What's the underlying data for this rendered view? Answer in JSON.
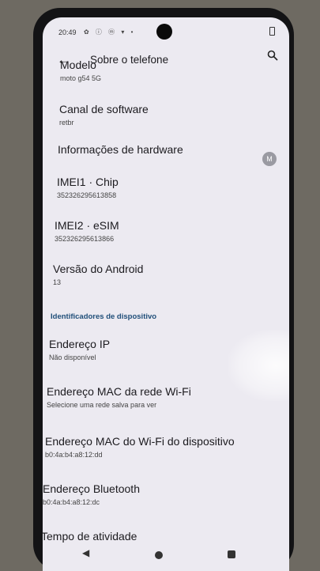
{
  "status_bar": {
    "time": "20:49",
    "icons": "✿ ⓘ ⓜ ▾ •"
  },
  "app_bar": {
    "back_glyph": "←",
    "title": "Sobre o telefone"
  },
  "items": [
    {
      "title": "Modelo",
      "subtitle": "moto g54 5G"
    },
    {
      "title": "Canal de software",
      "subtitle": "retbr"
    },
    {
      "title": "Informações de hardware",
      "subtitle": ""
    },
    {
      "title": "IMEI1 · Chip",
      "subtitle": "352326295613858"
    },
    {
      "title": "IMEI2 · eSIM",
      "subtitle": "352326295613866"
    },
    {
      "title": "Versão do Android",
      "subtitle": "13"
    },
    {
      "title": "Endereço IP",
      "subtitle": "Não disponível"
    },
    {
      "title": "Endereço MAC da rede Wi-Fi",
      "subtitle": "Selecione uma rede salva para ver"
    },
    {
      "title": "Endereço MAC do Wi-Fi do dispositivo",
      "subtitle": "b0:4a:b4:a8:12:dd"
    },
    {
      "title": "Endereço Bluetooth",
      "subtitle": "b0:4a:b4:a8:12:dc"
    },
    {
      "title": "Tempo de atividade",
      "subtitle": ""
    }
  ],
  "section_header": "Identificadores de dispositivo",
  "moto_badge": "M",
  "nav": {
    "back_glyph": "◀"
  }
}
